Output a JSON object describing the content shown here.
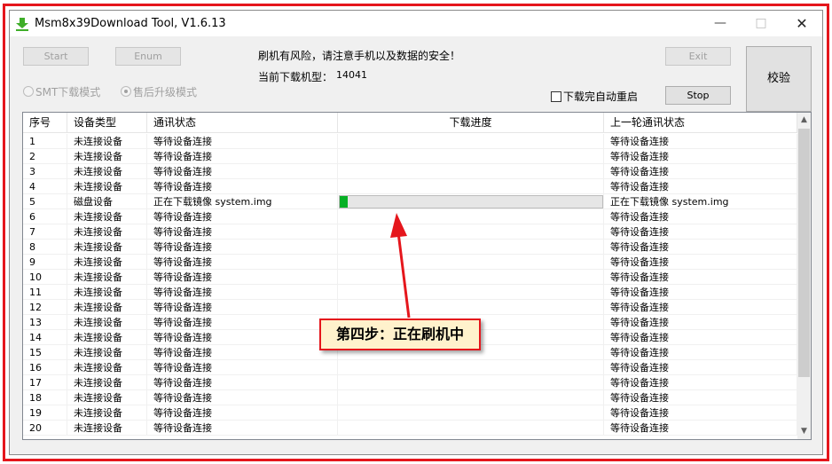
{
  "window": {
    "title": "Msm8x39Download Tool, V1.6.13"
  },
  "buttons": {
    "start": "Start",
    "enum": "Enum",
    "exit": "Exit",
    "stop": "Stop",
    "verify": "校验"
  },
  "radios": {
    "smt": "SMT下载模式",
    "aftersale": "售后升级模式"
  },
  "info": {
    "warning": "刷机有风险，请注意手机以及数据的安全！",
    "model_label": "当前下载机型：",
    "model_value": "14041"
  },
  "checkbox": {
    "auto_restart": "下载完自动重启"
  },
  "table": {
    "headers": [
      "序号",
      "设备类型",
      "通讯状态",
      "下载进度",
      "上一轮通讯状态"
    ],
    "rows": [
      {
        "id": "1",
        "type": "未连接设备",
        "status": "等待设备连接",
        "last": "等待设备连接"
      },
      {
        "id": "2",
        "type": "未连接设备",
        "status": "等待设备连接",
        "last": "等待设备连接"
      },
      {
        "id": "3",
        "type": "未连接设备",
        "status": "等待设备连接",
        "last": "等待设备连接"
      },
      {
        "id": "4",
        "type": "未连接设备",
        "status": "等待设备连接",
        "last": "等待设备连接"
      },
      {
        "id": "5",
        "type": "磁盘设备",
        "status": "正在下载镜像 system.img",
        "last": "正在下载镜像 system.img",
        "progress": 3
      },
      {
        "id": "6",
        "type": "未连接设备",
        "status": "等待设备连接",
        "last": "等待设备连接"
      },
      {
        "id": "7",
        "type": "未连接设备",
        "status": "等待设备连接",
        "last": "等待设备连接"
      },
      {
        "id": "8",
        "type": "未连接设备",
        "status": "等待设备连接",
        "last": "等待设备连接"
      },
      {
        "id": "9",
        "type": "未连接设备",
        "status": "等待设备连接",
        "last": "等待设备连接"
      },
      {
        "id": "10",
        "type": "未连接设备",
        "status": "等待设备连接",
        "last": "等待设备连接"
      },
      {
        "id": "11",
        "type": "未连接设备",
        "status": "等待设备连接",
        "last": "等待设备连接"
      },
      {
        "id": "12",
        "type": "未连接设备",
        "status": "等待设备连接",
        "last": "等待设备连接"
      },
      {
        "id": "13",
        "type": "未连接设备",
        "status": "等待设备连接",
        "last": "等待设备连接"
      },
      {
        "id": "14",
        "type": "未连接设备",
        "status": "等待设备连接",
        "last": "等待设备连接"
      },
      {
        "id": "15",
        "type": "未连接设备",
        "status": "等待设备连接",
        "last": "等待设备连接"
      },
      {
        "id": "16",
        "type": "未连接设备",
        "status": "等待设备连接",
        "last": "等待设备连接"
      },
      {
        "id": "17",
        "type": "未连接设备",
        "status": "等待设备连接",
        "last": "等待设备连接"
      },
      {
        "id": "18",
        "type": "未连接设备",
        "status": "等待设备连接",
        "last": "等待设备连接"
      },
      {
        "id": "19",
        "type": "未连接设备",
        "status": "等待设备连接",
        "last": "等待设备连接"
      },
      {
        "id": "20",
        "type": "未连接设备",
        "status": "等待设备连接",
        "last": "等待设备连接"
      }
    ]
  },
  "annotation": {
    "callout": "第四步：正在刷机中"
  },
  "colors": {
    "annotation_red": "#e5161c",
    "callout_fill": "#fff2cc",
    "progress_green": "#06b025"
  },
  "icons": [
    "download-arrow-icon",
    "minimize-icon",
    "maximize-icon",
    "close-icon",
    "scroll-up-icon",
    "scroll-down-icon"
  ]
}
